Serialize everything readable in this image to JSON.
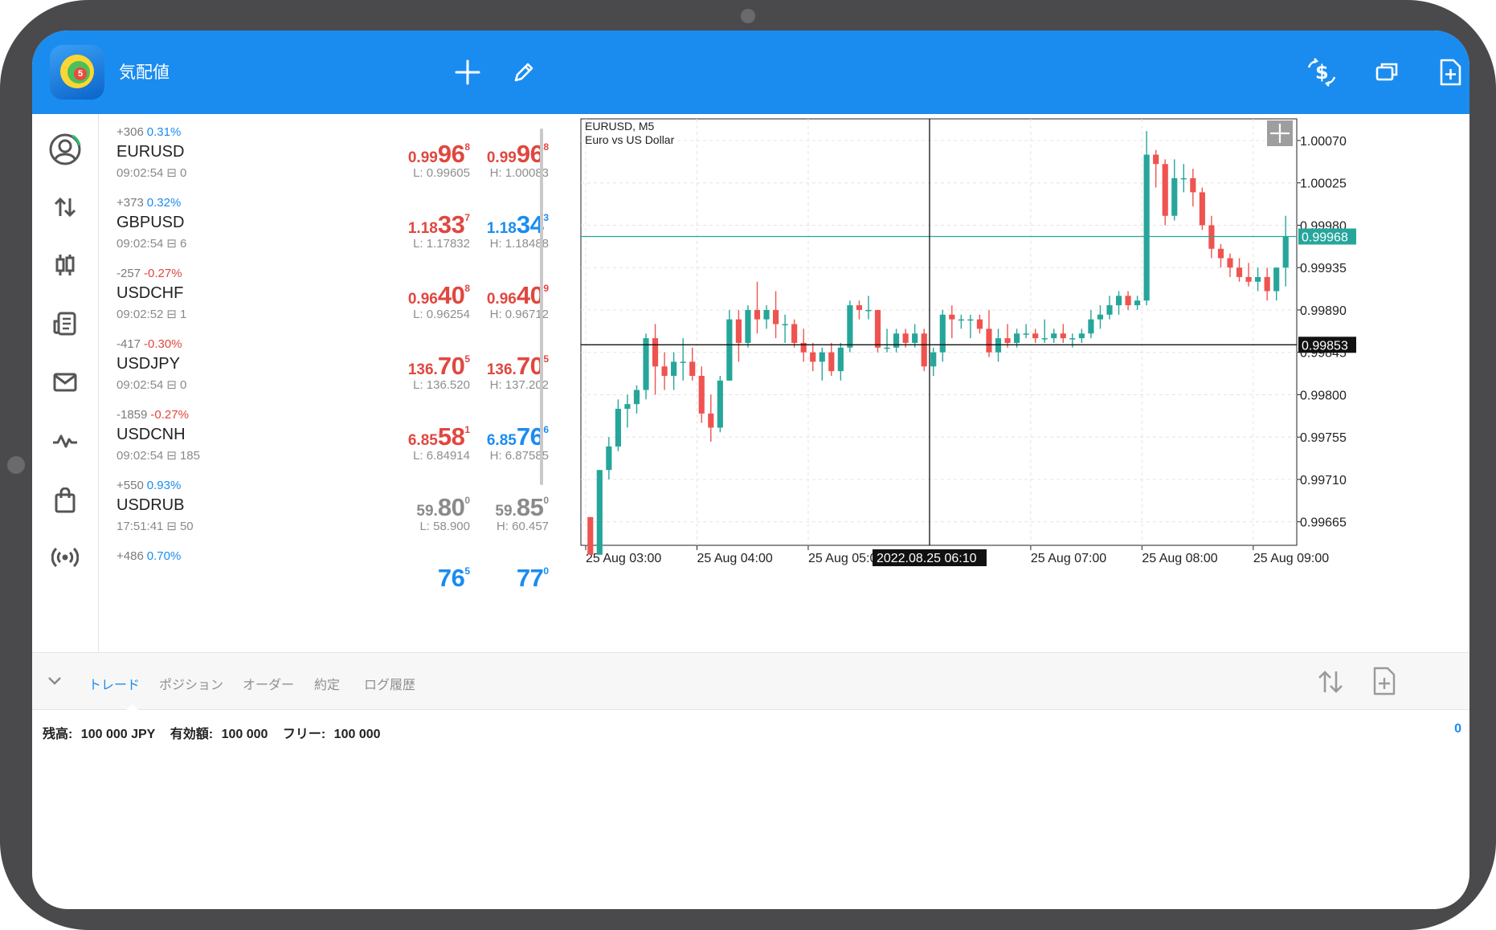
{
  "app": {
    "title": "気配値"
  },
  "toolbar": {
    "left_icons": [
      "add-icon",
      "pencil-icon"
    ],
    "right_icons": [
      "dollar-arrows-icon",
      "windows-icon",
      "new-document-icon"
    ]
  },
  "sidebar": {
    "icons": [
      "user-circle-icon",
      "arrows-updown-icon",
      "candles-icon",
      "news-icon",
      "mail-icon",
      "pulse-icon",
      "bag-icon",
      "signal-icon"
    ]
  },
  "quotes": [
    {
      "change": "+306",
      "change_pct": "0.31%",
      "direction": "up",
      "symbol": "EURUSD",
      "time": "09:02:54",
      "spread": "0",
      "bid": {
        "prefix": "0.99",
        "big": "96",
        "sup": "8",
        "color": "red"
      },
      "ask": {
        "prefix": "0.99",
        "big": "96",
        "sup": "8",
        "color": "red"
      },
      "low": "L: 0.99605",
      "high": "H: 1.00083"
    },
    {
      "change": "+373",
      "change_pct": "0.32%",
      "direction": "up",
      "symbol": "GBPUSD",
      "time": "09:02:54",
      "spread": "6",
      "bid": {
        "prefix": "1.18",
        "big": "33",
        "sup": "7",
        "color": "red"
      },
      "ask": {
        "prefix": "1.18",
        "big": "34",
        "sup": "3",
        "color": "blue"
      },
      "low": "L: 1.17832",
      "high": "H: 1.18488"
    },
    {
      "change": "-257",
      "change_pct": "-0.27%",
      "direction": "down",
      "symbol": "USDCHF",
      "time": "09:02:52",
      "spread": "1",
      "bid": {
        "prefix": "0.96",
        "big": "40",
        "sup": "8",
        "color": "red"
      },
      "ask": {
        "prefix": "0.96",
        "big": "40",
        "sup": "9",
        "color": "red"
      },
      "low": "L: 0.96254",
      "high": "H: 0.96712"
    },
    {
      "change": "-417",
      "change_pct": "-0.30%",
      "direction": "down",
      "symbol": "USDJPY",
      "time": "09:02:54",
      "spread": "0",
      "bid": {
        "prefix": "136.",
        "big": "70",
        "sup": "5",
        "color": "red"
      },
      "ask": {
        "prefix": "136.",
        "big": "70",
        "sup": "5",
        "color": "red"
      },
      "low": "L: 136.520",
      "high": "H: 137.202"
    },
    {
      "change": "-1859",
      "change_pct": "-0.27%",
      "direction": "down",
      "symbol": "USDCNH",
      "time": "09:02:54",
      "spread": "185",
      "bid": {
        "prefix": "6.85",
        "big": "58",
        "sup": "1",
        "color": "red"
      },
      "ask": {
        "prefix": "6.85",
        "big": "76",
        "sup": "6",
        "color": "blue"
      },
      "low": "L: 6.84914",
      "high": "H: 6.87585"
    },
    {
      "change": "+550",
      "change_pct": "0.93%",
      "direction": "up",
      "symbol": "USDRUB",
      "time": "17:51:41",
      "spread": "50",
      "bid": {
        "prefix": "59.",
        "big": "80",
        "sup": "0",
        "color": "gray"
      },
      "ask": {
        "prefix": "59.",
        "big": "85",
        "sup": "0",
        "color": "gray"
      },
      "low": "L: 58.900",
      "high": "H: 60.457"
    },
    {
      "change": "+486",
      "change_pct": "0.70%",
      "direction": "up",
      "symbol": "",
      "time": "",
      "spread": "",
      "bid": {
        "prefix": "",
        "big": "76",
        "sup": "5",
        "color": "blue"
      },
      "ask": {
        "prefix": "",
        "big": "77",
        "sup": "0",
        "color": "blue"
      },
      "low": "",
      "high": ""
    }
  ],
  "chart": {
    "symbol_tf": "EURUSD, M5",
    "description": "Euro vs US Dollar",
    "bid_label": "0.99968",
    "crosshair_price": "0.99853",
    "crosshair_time": "2022.08.25 06:10"
  },
  "chart_data": {
    "type": "candlestick",
    "symbol": "EURUSD",
    "timeframe": "M5",
    "y_ticks": [
      "1.00070",
      "1.00025",
      "0.99980",
      "0.99935",
      "0.99890",
      "0.99845",
      "0.99800",
      "0.99755",
      "0.99710",
      "0.99665"
    ],
    "x_ticks": [
      "25 Aug 03:00",
      "25 Aug 04:00",
      "25 Aug 05:00",
      "25 Aug 07:00",
      "25 Aug 08:00",
      "25 Aug 09:00"
    ],
    "ylim": [
      0.9964,
      1.00093
    ],
    "bid_line": 0.99968,
    "crosshair": {
      "price": 0.99853,
      "time": "2022.08.25 06:10"
    },
    "colors": {
      "bull": "#26a69a",
      "bear": "#ef5350",
      "bid_line": "#26a69a"
    },
    "candles": [
      {
        "o": 0.9967,
        "h": 0.9967,
        "l": 0.9963,
        "c": 0.9963
      },
      {
        "o": 0.9963,
        "h": 0.9972,
        "l": 0.9963,
        "c": 0.9972
      },
      {
        "o": 0.9972,
        "h": 0.99755,
        "l": 0.9971,
        "c": 0.99745
      },
      {
        "o": 0.99745,
        "h": 0.99795,
        "l": 0.9974,
        "c": 0.99785
      },
      {
        "o": 0.99785,
        "h": 0.998,
        "l": 0.99765,
        "c": 0.9979
      },
      {
        "o": 0.9979,
        "h": 0.9981,
        "l": 0.9978,
        "c": 0.99805
      },
      {
        "o": 0.99805,
        "h": 0.99865,
        "l": 0.99795,
        "c": 0.9986
      },
      {
        "o": 0.9986,
        "h": 0.99875,
        "l": 0.998,
        "c": 0.9983
      },
      {
        "o": 0.9983,
        "h": 0.99845,
        "l": 0.99805,
        "c": 0.9982
      },
      {
        "o": 0.9982,
        "h": 0.99845,
        "l": 0.99805,
        "c": 0.99835
      },
      {
        "o": 0.99835,
        "h": 0.9986,
        "l": 0.99815,
        "c": 0.99835
      },
      {
        "o": 0.99835,
        "h": 0.9985,
        "l": 0.99815,
        "c": 0.9982
      },
      {
        "o": 0.9982,
        "h": 0.9983,
        "l": 0.9977,
        "c": 0.9978
      },
      {
        "o": 0.9978,
        "h": 0.998,
        "l": 0.9975,
        "c": 0.99765
      },
      {
        "o": 0.99765,
        "h": 0.9982,
        "l": 0.9976,
        "c": 0.99815
      },
      {
        "o": 0.99815,
        "h": 0.9989,
        "l": 0.99815,
        "c": 0.9988
      },
      {
        "o": 0.9988,
        "h": 0.9989,
        "l": 0.99835,
        "c": 0.99855
      },
      {
        "o": 0.99855,
        "h": 0.99895,
        "l": 0.9985,
        "c": 0.9989
      },
      {
        "o": 0.9989,
        "h": 0.9992,
        "l": 0.99865,
        "c": 0.9988
      },
      {
        "o": 0.9988,
        "h": 0.99895,
        "l": 0.9987,
        "c": 0.9989
      },
      {
        "o": 0.9989,
        "h": 0.9991,
        "l": 0.9986,
        "c": 0.99875
      },
      {
        "o": 0.99875,
        "h": 0.99885,
        "l": 0.99855,
        "c": 0.99875
      },
      {
        "o": 0.99875,
        "h": 0.9988,
        "l": 0.9985,
        "c": 0.99855
      },
      {
        "o": 0.99855,
        "h": 0.9987,
        "l": 0.99835,
        "c": 0.99845
      },
      {
        "o": 0.99845,
        "h": 0.99855,
        "l": 0.99825,
        "c": 0.99835
      },
      {
        "o": 0.99835,
        "h": 0.9985,
        "l": 0.99815,
        "c": 0.99845
      },
      {
        "o": 0.99845,
        "h": 0.99855,
        "l": 0.9982,
        "c": 0.99825
      },
      {
        "o": 0.99825,
        "h": 0.99855,
        "l": 0.99815,
        "c": 0.9985
      },
      {
        "o": 0.9985,
        "h": 0.999,
        "l": 0.99845,
        "c": 0.99895
      },
      {
        "o": 0.99895,
        "h": 0.999,
        "l": 0.9988,
        "c": 0.9989
      },
      {
        "o": 0.9989,
        "h": 0.99905,
        "l": 0.9988,
        "c": 0.9989
      },
      {
        "o": 0.9989,
        "h": 0.9989,
        "l": 0.99845,
        "c": 0.9985
      },
      {
        "o": 0.9985,
        "h": 0.9987,
        "l": 0.99845,
        "c": 0.9985
      },
      {
        "o": 0.9985,
        "h": 0.9987,
        "l": 0.99845,
        "c": 0.99865
      },
      {
        "o": 0.99865,
        "h": 0.9987,
        "l": 0.9985,
        "c": 0.99855
      },
      {
        "o": 0.99855,
        "h": 0.99875,
        "l": 0.9985,
        "c": 0.99865
      },
      {
        "o": 0.99865,
        "h": 0.9987,
        "l": 0.99825,
        "c": 0.9983
      },
      {
        "o": 0.9983,
        "h": 0.9985,
        "l": 0.9982,
        "c": 0.99845
      },
      {
        "o": 0.99845,
        "h": 0.9989,
        "l": 0.99835,
        "c": 0.99885
      },
      {
        "o": 0.99885,
        "h": 0.99895,
        "l": 0.9986,
        "c": 0.9988
      },
      {
        "o": 0.9988,
        "h": 0.99885,
        "l": 0.9987,
        "c": 0.9988
      },
      {
        "o": 0.9988,
        "h": 0.99885,
        "l": 0.9986,
        "c": 0.9988
      },
      {
        "o": 0.9988,
        "h": 0.99885,
        "l": 0.99865,
        "c": 0.9987
      },
      {
        "o": 0.9987,
        "h": 0.9989,
        "l": 0.9984,
        "c": 0.99845
      },
      {
        "o": 0.99845,
        "h": 0.9987,
        "l": 0.99835,
        "c": 0.9986
      },
      {
        "o": 0.9986,
        "h": 0.99875,
        "l": 0.9985,
        "c": 0.99855
      },
      {
        "o": 0.99855,
        "h": 0.9987,
        "l": 0.9985,
        "c": 0.99865
      },
      {
        "o": 0.99865,
        "h": 0.99875,
        "l": 0.9986,
        "c": 0.99865
      },
      {
        "o": 0.99865,
        "h": 0.9987,
        "l": 0.99855,
        "c": 0.9986
      },
      {
        "o": 0.9986,
        "h": 0.9988,
        "l": 0.99855,
        "c": 0.9986
      },
      {
        "o": 0.9986,
        "h": 0.9987,
        "l": 0.99855,
        "c": 0.99865
      },
      {
        "o": 0.99865,
        "h": 0.99875,
        "l": 0.99855,
        "c": 0.9986
      },
      {
        "o": 0.9986,
        "h": 0.99865,
        "l": 0.9985,
        "c": 0.9986
      },
      {
        "o": 0.9986,
        "h": 0.9987,
        "l": 0.99855,
        "c": 0.99865
      },
      {
        "o": 0.99865,
        "h": 0.9989,
        "l": 0.9986,
        "c": 0.9988
      },
      {
        "o": 0.9988,
        "h": 0.99895,
        "l": 0.9987,
        "c": 0.99885
      },
      {
        "o": 0.99885,
        "h": 0.99905,
        "l": 0.9988,
        "c": 0.99895
      },
      {
        "o": 0.99895,
        "h": 0.9991,
        "l": 0.99885,
        "c": 0.99905
      },
      {
        "o": 0.99905,
        "h": 0.9991,
        "l": 0.9989,
        "c": 0.99895
      },
      {
        "o": 0.99895,
        "h": 0.99905,
        "l": 0.9989,
        "c": 0.999
      },
      {
        "o": 0.999,
        "h": 1.0008,
        "l": 0.99895,
        "c": 1.00055
      },
      {
        "o": 1.00055,
        "h": 1.0006,
        "l": 1.0002,
        "c": 1.00045
      },
      {
        "o": 1.00045,
        "h": 1.0005,
        "l": 0.9998,
        "c": 0.9999
      },
      {
        "o": 0.9999,
        "h": 1.0005,
        "l": 0.99985,
        "c": 1.0003
      },
      {
        "o": 1.0003,
        "h": 1.00045,
        "l": 1.00015,
        "c": 1.0003
      },
      {
        "o": 1.0003,
        "h": 1.0004,
        "l": 1.0,
        "c": 1.00015
      },
      {
        "o": 1.00015,
        "h": 1.0002,
        "l": 0.99975,
        "c": 0.9998
      },
      {
        "o": 0.9998,
        "h": 0.9999,
        "l": 0.99945,
        "c": 0.99955
      },
      {
        "o": 0.99955,
        "h": 0.9996,
        "l": 0.99935,
        "c": 0.99945
      },
      {
        "o": 0.99945,
        "h": 0.9995,
        "l": 0.99925,
        "c": 0.99935
      },
      {
        "o": 0.99935,
        "h": 0.99945,
        "l": 0.9992,
        "c": 0.99925
      },
      {
        "o": 0.99925,
        "h": 0.9994,
        "l": 0.99915,
        "c": 0.9992
      },
      {
        "o": 0.9992,
        "h": 0.99935,
        "l": 0.9991,
        "c": 0.99925
      },
      {
        "o": 0.99925,
        "h": 0.99935,
        "l": 0.999,
        "c": 0.9991
      },
      {
        "o": 0.9991,
        "h": 0.99935,
        "l": 0.999,
        "c": 0.99935
      },
      {
        "o": 0.99935,
        "h": 0.9999,
        "l": 0.99915,
        "c": 0.99968
      }
    ]
  },
  "bottom_tabs": [
    "トレード",
    "ポジション",
    "オーダー",
    "約定",
    "ログ履歴"
  ],
  "account": {
    "balance_label": "残高:",
    "balance_value": "100 000 JPY",
    "equity_label": "有効額:",
    "equity_value": "100 000",
    "free_label": "フリー:",
    "free_value": "100 000",
    "profit": "0"
  }
}
